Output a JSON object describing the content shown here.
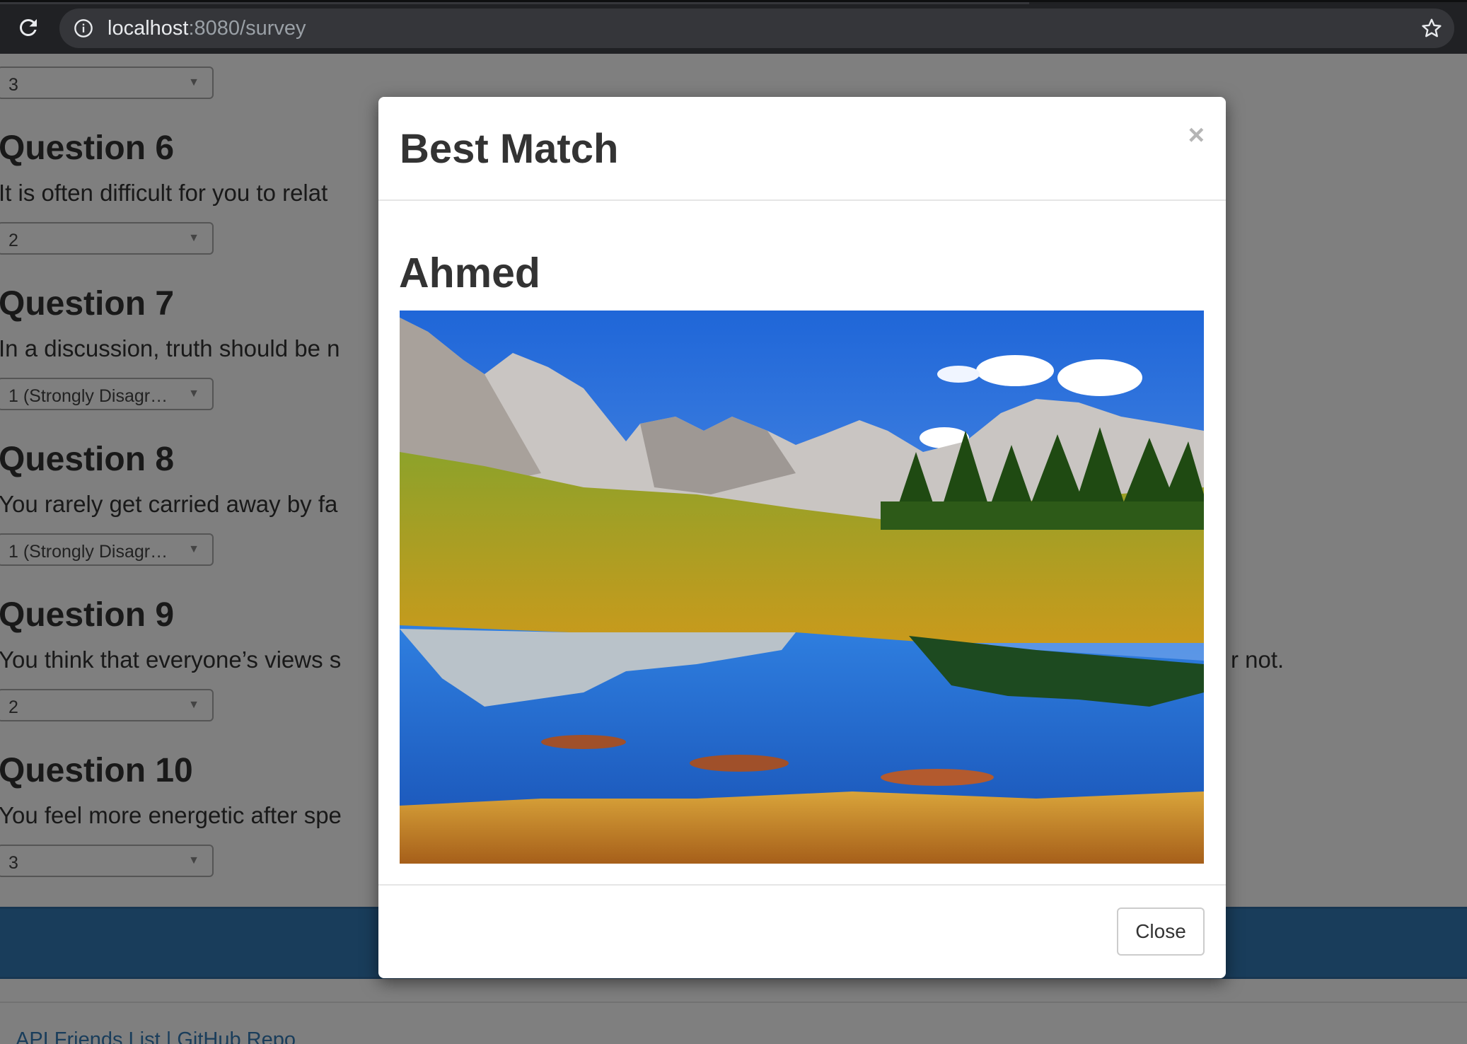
{
  "browser": {
    "url_host": "localhost",
    "url_rest": ":8080/survey"
  },
  "survey": {
    "top_select_value": "3",
    "questions": [
      {
        "title": "Question 6",
        "text": "It is often difficult for you to relat",
        "answer": "2"
      },
      {
        "title": "Question 7",
        "text": "In a discussion, truth should be n",
        "answer": "1 (Strongly Disagr…"
      },
      {
        "title": "Question 8",
        "text": "You rarely get carried away by fa",
        "answer": "1 (Strongly Disagr…"
      },
      {
        "title": "Question 9",
        "text": "You think that everyone’s views s",
        "text_tail": "r not.",
        "answer": "2"
      },
      {
        "title": "Question 10",
        "text": "You feel more energetic after spe",
        "answer": "3"
      }
    ]
  },
  "footer": {
    "link_api": "API Friends List",
    "separator": " | ",
    "link_github": "GitHub Repo"
  },
  "modal": {
    "title": "Best Match",
    "close_x": "×",
    "match_name": "Ahmed",
    "close_label": "Close"
  },
  "colors": {
    "submit_bar": "#337ab7",
    "browser_chrome": "#202124",
    "backdrop": "rgba(0,0,0,0.5)"
  }
}
